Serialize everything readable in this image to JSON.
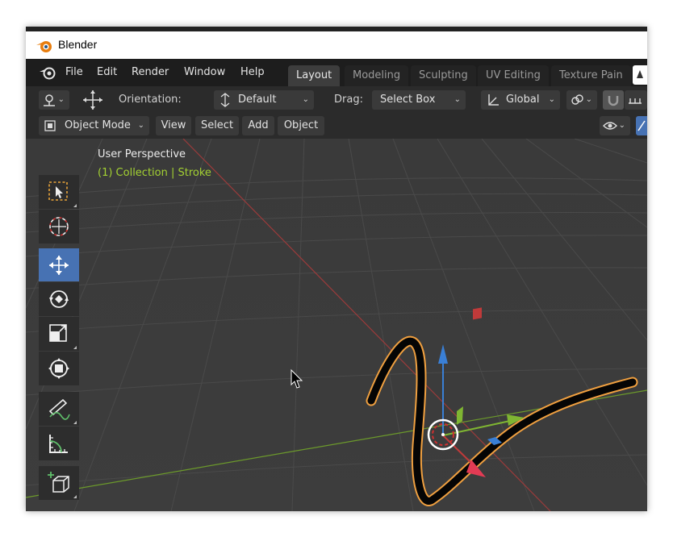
{
  "window": {
    "title": "Blender"
  },
  "menubar": {
    "items": [
      "File",
      "Edit",
      "Render",
      "Window",
      "Help"
    ],
    "workspace_tabs": [
      {
        "label": "Layout",
        "active": true
      },
      {
        "label": "Modeling",
        "active": false
      },
      {
        "label": "Sculpting",
        "active": false
      },
      {
        "label": "UV Editing",
        "active": false
      },
      {
        "label": "Texture Pain",
        "active": false
      }
    ]
  },
  "header": {
    "orientation_label": "Orientation:",
    "orientation_value": "Default",
    "drag_label": "Drag:",
    "drag_value": "Select Box",
    "transform_orientation": "Global"
  },
  "header2": {
    "mode": "Object Mode",
    "menus": [
      "View",
      "Select",
      "Add",
      "Object"
    ]
  },
  "viewport": {
    "perspective": "User Perspective",
    "collection_info": "(1) Collection | Stroke"
  },
  "toolbar": {
    "tools": [
      {
        "name": "select-box-tool",
        "icon": "select-box-icon",
        "active": false
      },
      {
        "name": "cursor-tool",
        "icon": "cursor-icon",
        "active": false
      },
      {
        "name": "move-tool",
        "icon": "move-icon",
        "active": true
      },
      {
        "name": "rotate-tool",
        "icon": "rotate-icon",
        "active": false
      },
      {
        "name": "scale-tool",
        "icon": "scale-icon",
        "active": false
      },
      {
        "name": "transform-tool",
        "icon": "transform-icon",
        "active": false
      },
      {
        "name": "annotate-tool",
        "icon": "annotate-icon",
        "active": false
      },
      {
        "name": "measure-tool",
        "icon": "measure-icon",
        "active": false
      },
      {
        "name": "add-cube-tool",
        "icon": "add-cube-icon",
        "active": false
      }
    ]
  },
  "colors": {
    "accent": "#4772b3",
    "selection_outline": "#f0a040",
    "x_axis": "#c03a3a",
    "y_axis": "#7fb532",
    "z_axis": "#3a7fd5",
    "info_text": "#a3d132"
  }
}
